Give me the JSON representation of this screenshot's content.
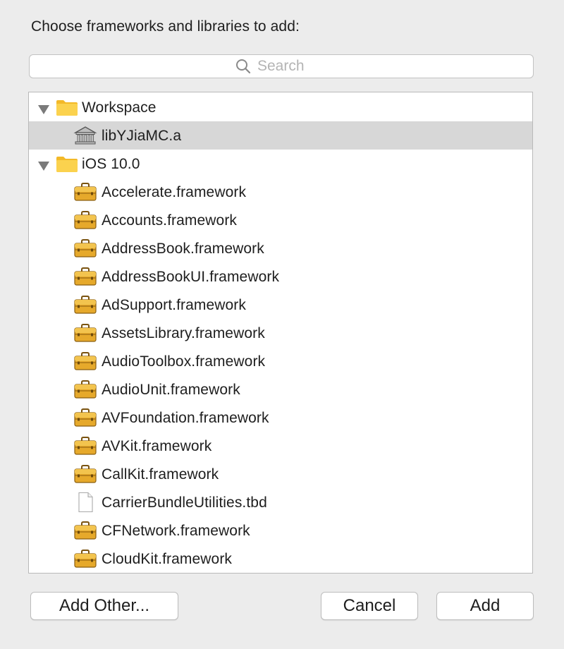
{
  "dialog": {
    "title": "Choose frameworks and libraries to add:"
  },
  "search": {
    "placeholder": "Search",
    "value": ""
  },
  "tree": {
    "rows": [
      {
        "label": "Workspace",
        "kind": "group",
        "icon": "folder-icon",
        "expanded": true
      },
      {
        "label": "libYJiaMC.a",
        "kind": "library",
        "icon": "library-icon",
        "selected": true
      },
      {
        "label": "iOS 10.0",
        "kind": "group",
        "icon": "folder-icon",
        "expanded": true
      },
      {
        "label": "Accelerate.framework",
        "kind": "framework",
        "icon": "toolbox-icon"
      },
      {
        "label": "Accounts.framework",
        "kind": "framework",
        "icon": "toolbox-icon"
      },
      {
        "label": "AddressBook.framework",
        "kind": "framework",
        "icon": "toolbox-icon"
      },
      {
        "label": "AddressBookUI.framework",
        "kind": "framework",
        "icon": "toolbox-icon"
      },
      {
        "label": "AdSupport.framework",
        "kind": "framework",
        "icon": "toolbox-icon"
      },
      {
        "label": "AssetsLibrary.framework",
        "kind": "framework",
        "icon": "toolbox-icon"
      },
      {
        "label": "AudioToolbox.framework",
        "kind": "framework",
        "icon": "toolbox-icon"
      },
      {
        "label": "AudioUnit.framework",
        "kind": "framework",
        "icon": "toolbox-icon"
      },
      {
        "label": "AVFoundation.framework",
        "kind": "framework",
        "icon": "toolbox-icon"
      },
      {
        "label": "AVKit.framework",
        "kind": "framework",
        "icon": "toolbox-icon"
      },
      {
        "label": "CallKit.framework",
        "kind": "framework",
        "icon": "toolbox-icon"
      },
      {
        "label": "CarrierBundleUtilities.tbd",
        "kind": "file",
        "icon": "document-icon"
      },
      {
        "label": "CFNetwork.framework",
        "kind": "framework",
        "icon": "toolbox-icon"
      },
      {
        "label": "CloudKit.framework",
        "kind": "framework",
        "icon": "toolbox-icon"
      }
    ]
  },
  "buttons": {
    "add_other": "Add Other...",
    "cancel": "Cancel",
    "add": "Add"
  },
  "colors": {
    "window_bg": "#ececec",
    "selection_bg": "#d7d7d7",
    "folder_yellow": "#f8c93b",
    "toolbox_gold": "#e0a526"
  }
}
